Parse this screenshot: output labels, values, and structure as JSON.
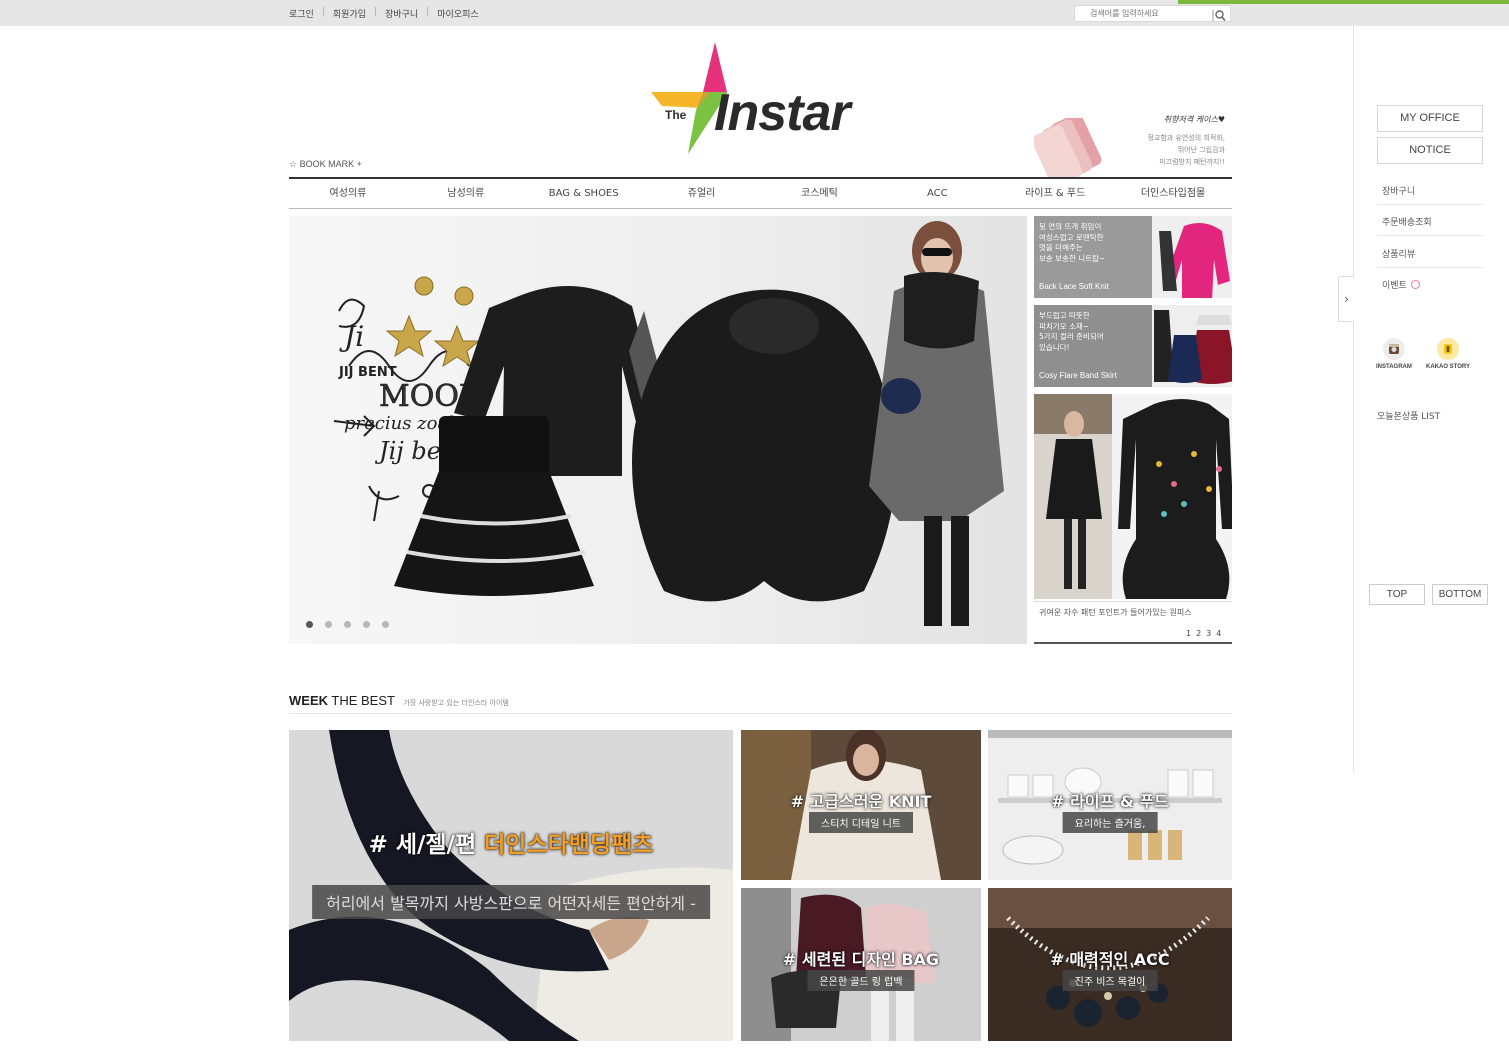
{
  "topbar": {
    "links": [
      "로그인",
      "회원가입",
      "장바구니",
      "마이오피스"
    ],
    "search_placeholder": "검색어를 입력하세요"
  },
  "header": {
    "logo_small": "The",
    "logo_word": "Instar",
    "bookmark": "BOOK MARK +",
    "promo_title": "취향저격 케이스♥",
    "promo_text": "정교함과 유연성의 최적화,\n뛰어난 그립감과\n미끄럼방지 패턴까지!!"
  },
  "gnb": [
    "여성의류",
    "남성의류",
    "BAG & SHOES",
    "쥬얼리",
    "코스메틱",
    "ACC",
    "라이프 & 푸드",
    "더인스타입점몰"
  ],
  "hero": {
    "slide_count": 5,
    "active_slide": 1
  },
  "side_banners": [
    {
      "text": "뒷 면의 뜨개 취임이\n여성스럽고 로맨틱한\n멋을 더해주는\n보송 보송한 니트탑~",
      "caption": "Back Lace Soft Knit"
    },
    {
      "text": "부드럽고 따뜻한\n피치기모 소재~\n5가지 컬러 준비되어\n있습니다!",
      "caption": "Cosy Flare Band Skirt"
    },
    {
      "caption": "귀여운 자수 패턴 포인트가 들어가있는 원피스"
    }
  ],
  "side_pager": "1234",
  "week_best": {
    "title_bold": "WEEK",
    "title_rest": "THE BEST",
    "subtitle": "가장 사랑받고 있는 더인스타 아이템",
    "tiles": [
      {
        "head_prefix": "# 세/젤/편 ",
        "head_highlight": "더인스타밴딩팬츠",
        "pill": "허리에서 발목까지 사방스판으로 어떤자세든 편안하게 -"
      },
      {
        "head": "# 고급스러운 KNIT",
        "pill": "스티치 디테일 니트"
      },
      {
        "head": "# 라이프 & 푸드",
        "pill": "요리하는 즐거움,"
      },
      {
        "head": "# 세련된 디자인 BAG",
        "pill": "은은한 골드 링 럽백"
      },
      {
        "head": "# 매력적인 ACC",
        "pill": "진주 비즈 목걸이"
      }
    ]
  },
  "quick_menu": {
    "buttons": [
      "MY OFFICE",
      "NOTICE"
    ],
    "links": [
      "장바구니",
      "주문배송조회",
      "상품리뷰",
      "이벤트"
    ],
    "social": [
      "INSTAGRAM",
      "KAKAO STORY"
    ],
    "today_list": "오늘본상품 LIST",
    "top": "TOP",
    "bottom": "BOTTOM",
    "toggle": "›"
  },
  "colors": {
    "accent_green": "#7db83e",
    "logo_pink": "#e6327d",
    "logo_yellow": "#f5b629",
    "logo_green": "#7cc242",
    "highlight_orange": "#f39e26"
  }
}
